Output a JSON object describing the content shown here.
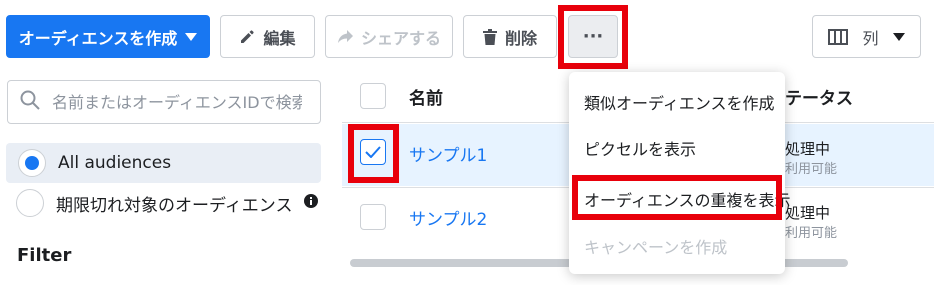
{
  "toolbar": {
    "create_audience": "オーディエンスを作成",
    "edit": "編集",
    "share": "シェアする",
    "delete": "削除",
    "more": "···",
    "columns": "列"
  },
  "sidebar": {
    "search_placeholder": "名前またはオーディエンスIDで検索",
    "filters": [
      {
        "label": "All audiences",
        "selected": true
      },
      {
        "label": "期限切れ対象のオーディエンス",
        "selected": false
      }
    ],
    "filter_heading": "Filter"
  },
  "table": {
    "header_name": "名前",
    "header_status": "テータス",
    "rows": [
      {
        "name": "サンプル1",
        "checked": true,
        "status": "処理中",
        "availability": "利用可能"
      },
      {
        "name": "サンプル2",
        "checked": false,
        "status": "処理中",
        "availability": "利用可能"
      }
    ]
  },
  "menu": {
    "items": [
      {
        "label": "類似オーディエンスを作成",
        "disabled": false
      },
      {
        "label": "ピクセルを表示",
        "disabled": false
      },
      {
        "label": "オーディエンスの重複を表示",
        "disabled": false
      },
      {
        "label": "キャンペーンを作成",
        "disabled": true
      }
    ]
  },
  "colors": {
    "accent": "#1877f2",
    "highlight_border": "#e8000b",
    "selected_row_bg": "#e7f3ff",
    "sidebar_selected_bg": "#e9eef5"
  },
  "icons": [
    "dropdown-triangle-icon",
    "pencil-icon",
    "share-arrow-icon",
    "trash-icon",
    "more-icon",
    "columns-icon",
    "search-icon",
    "info-icon",
    "checkmark-icon"
  ]
}
